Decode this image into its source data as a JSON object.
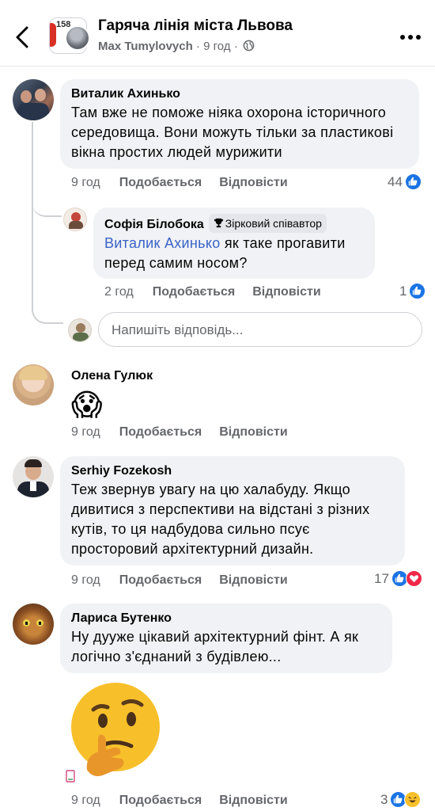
{
  "header": {
    "title": "Гаряча лінія міста Львова",
    "author": "Max Tumylovych",
    "separator": " · ",
    "time": "9 год",
    "separator2": " · ",
    "logo_text": "158"
  },
  "colors": {
    "accent": "#1b74e4",
    "bubble": "#f0f2f5",
    "muted": "#65676b",
    "mention": "#3a62c8"
  },
  "actions": {
    "like": "Подобається",
    "reply": "Відповісти"
  },
  "comments": [
    {
      "name": "Виталик Ахинько",
      "text": "Там вже не поможе ніяка охорона історичного середовища. Вони можуть тільки за пластикові вікна простих людей мурижити",
      "time": "9 год",
      "reactions": "44",
      "reaction_icons": [
        "like-icon"
      ],
      "replies": [
        {
          "name": "Софія Білобока",
          "badge": "Зірковий співавтор",
          "mention": "Виталик Ахинько",
          "text": " як таке прогавити перед самим носом?",
          "time": "2 год",
          "reactions": "1",
          "reaction_icons": [
            "like-icon"
          ]
        }
      ],
      "reply_placeholder": "Напишіть відповідь..."
    },
    {
      "name": "Олена Гулюк",
      "emoji": "😱",
      "time": "9 год"
    },
    {
      "name": "Serhiy Fozekosh",
      "text": "Теж звернув увагу на цю халабуду. Якщо дивитися з перспективи на відстані з різних кутів, то ця надбудова сильно псує просторовий архітектурний дизайн.",
      "time": "9 год",
      "reactions": "17",
      "reaction_icons": [
        "like-icon",
        "love-icon"
      ]
    },
    {
      "name": "Лариса Бутенко",
      "text": "Ну дууже цікавий архітектурний фінт. А як логічно з'єднаний з будівлею...",
      "sticker": "thinking-face",
      "time": "9 год",
      "reactions": "3",
      "reaction_icons": [
        "like-icon",
        "haha-icon"
      ]
    }
  ]
}
